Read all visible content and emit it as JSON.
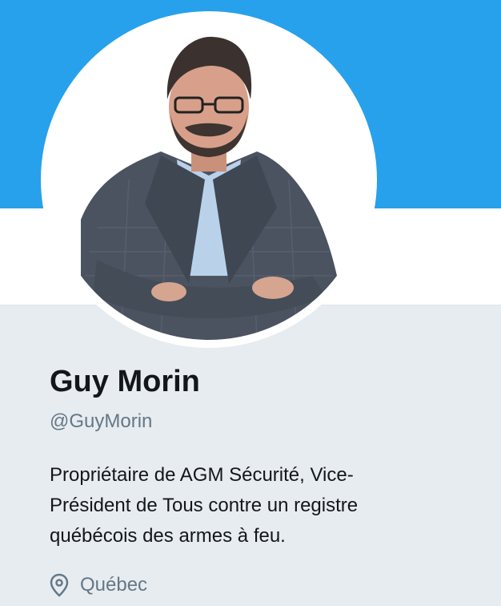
{
  "profile": {
    "display_name": "Guy Morin",
    "handle": "@GuyMorin",
    "bio_lines": [
      "Propriétaire de AGM Sécurité, Vice-",
      "Président de Tous contre un registre",
      "québécois des armes à feu."
    ],
    "location": "Québec",
    "avatar_icon": "profile-photo",
    "location_icon": "location-pin-icon"
  },
  "colors": {
    "banner": "#27a1eb",
    "background": "#e6ecf0",
    "name": "#14171a",
    "secondary_text": "#657786"
  }
}
